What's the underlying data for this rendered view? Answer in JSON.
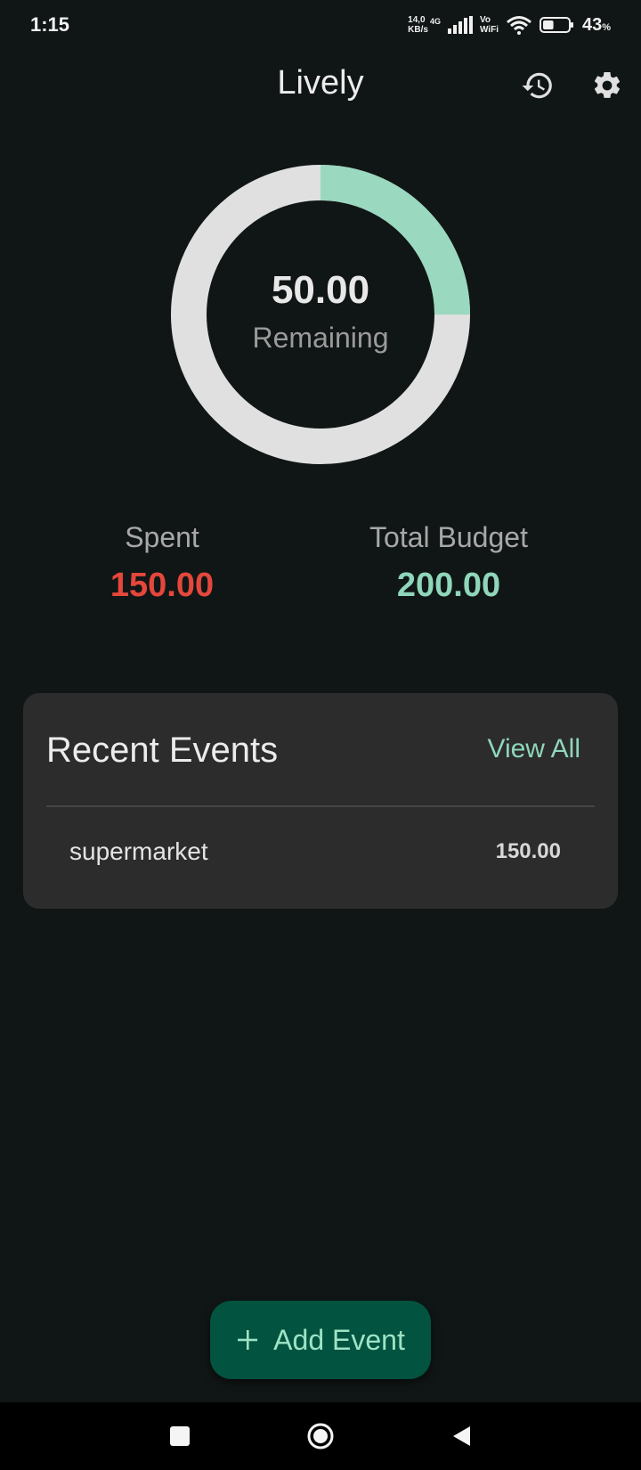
{
  "status_bar": {
    "time": "1:15",
    "net_speed_value": "14,0",
    "net_speed_unit": "KB/s",
    "net_type": "4G",
    "vowifi_top": "Vo",
    "vowifi_bottom": "WiFi",
    "battery_percent": "43",
    "battery_percent_sign": "%",
    "battery_level": 0.43
  },
  "header": {
    "title": "Lively",
    "history_icon": "history-icon",
    "settings_icon": "gear-icon"
  },
  "budget": {
    "remaining_value": "50.00",
    "remaining_label": "Remaining",
    "spent_label": "Spent",
    "spent_value": "150.00",
    "total_label": "Total Budget",
    "total_value": "200.00",
    "remaining_fraction": 0.25
  },
  "recent_events": {
    "title": "Recent Events",
    "view_all_label": "View All",
    "items": [
      {
        "name": "supermarket",
        "amount": "150.00"
      }
    ]
  },
  "fab": {
    "label": "Add Event",
    "icon": "plus-icon"
  },
  "colors": {
    "background": "#101615",
    "accent": "#8fd6bb",
    "ring_remaining": "#9ad8bf",
    "ring_spent": "#e0e0e0",
    "spent": "#e5473c",
    "fab_bg": "#02533f",
    "card_bg": "#2c2c2c"
  }
}
